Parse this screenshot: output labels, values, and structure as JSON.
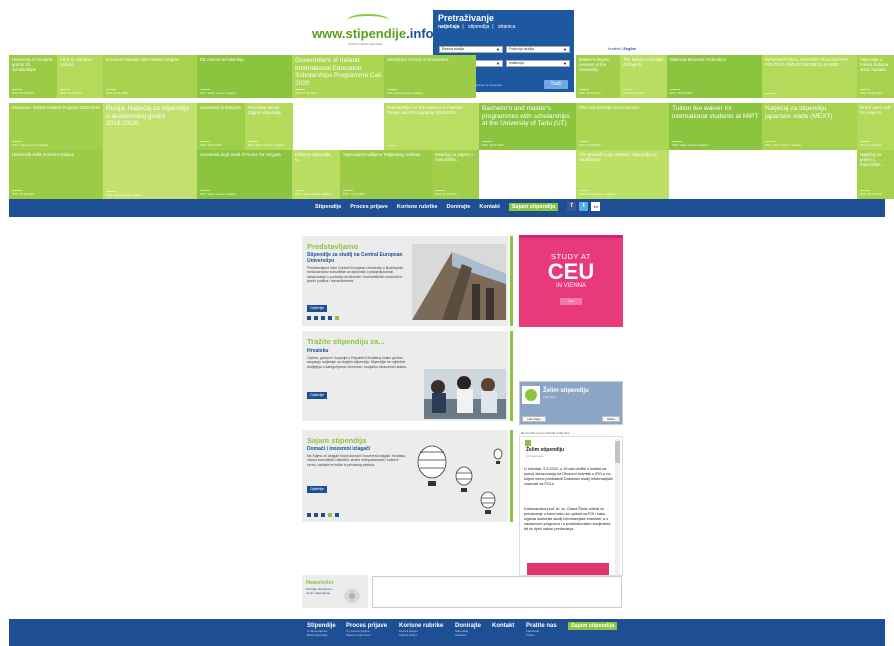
{
  "header": {
    "logo_text_main": "www.stipendije",
    "logo_text_domain": ".info",
    "logo_tagline": "Portal hrvatskih stipendija"
  },
  "search": {
    "title": "Pretraživanje",
    "tab_active": "natječaja",
    "tab_sep1": "|",
    "tab_2": "stipendija",
    "tab_sep2": "|",
    "tab_3": "stranica",
    "field_1": "Razina studija",
    "field_2": "Područje studija",
    "field_3": "Mjesto studija",
    "field_4": "Institucija",
    "note": "Pretraživanje objavljenih natječaja za stipendije",
    "button": "Traži"
  },
  "lang": {
    "hr": "Hrvatski",
    "sep": "|",
    "en": "English"
  },
  "tiles": [
    {
      "title": "University of Insubria grants 10 scholarships",
      "date": "ROK: 30.09.2020.",
      "small": true
    },
    {
      "title": "I.D.E.S. Summer School",
      "date": "ROK: 30.06.2020.",
      "small": true
    },
    {
      "title": "Erasmus Mundus Joint Master Degree",
      "date": "ROK: 30.01.2020.",
      "small": true
    },
    {
      "title": "DE Alumni Scholarship",
      "date": "ROK: stalno otvoren natječaj",
      "small": true
    },
    {
      "title": "Government of Ireland International Education Scholarships Programme Call 2020",
      "date": "ROK: 27.01.2020.",
      "small": false
    },
    {
      "title": "Stockholm School of Economics",
      "date": "ROK: stalno otvoren natječaj",
      "small": true
    },
    {
      "title": "Master's degree courses at the University",
      "date": "ROK: 10.03.2020.",
      "small": true
    },
    {
      "title": "The Italian Consulate of Zagreb",
      "date": "ROK: 31.03.2020.",
      "small": true
    },
    {
      "title": "Wallonia-Brussels Federation",
      "date": "ROK: 28.02.2020.",
      "small": true
    },
    {
      "title": "INTERNATIONAL MASTER: PHILOSOPHY, POLITICS AND ECONOMICS IN MED",
      "date": "",
      "small": true
    },
    {
      "title": "Stipendije u Fondu Šabana Jovic Šabana",
      "date": "ROK: 20.01.2020.",
      "small": true
    },
    {
      "title": "Erasmus+ Institut Pasteur Projects 2019-2010",
      "date": "ROK: stalno otvoren natječaj",
      "small": true
    },
    {
      "title": "Rusija: Natječaj za stipendije u akademskoj godini 2019./2020.",
      "date": "ROK: stalno otvoren natječaj",
      "small": false
    },
    {
      "title": "Università di Bologna",
      "date": "ROK: 10.02.2020.",
      "small": true
    },
    {
      "title": "Privredna banka Zagreb stipendije",
      "date": "ROK: stalno otvoren natječaj",
      "small": true
    },
    {
      "title": "Scholarships for the Masters in Fashion, Design and Photography 2020/2021",
      "date": "",
      "small": true
    },
    {
      "title": "Bachelor's and master's programmes with scholarships at the University of Tartu (UT)",
      "date": "ROK: 15.02.2020.",
      "small": false
    },
    {
      "title": "PhD scholarships in Economics",
      "date": "ROK: 10.08.2020.",
      "small": true
    },
    {
      "title": "Tuition fee waiver for international students at MIPT",
      "date": "ROK: stalno otvoren natječaj",
      "small": false
    },
    {
      "title": "Natječaj za stipendiju japanske vlade (MEXT)",
      "date": "ROK: stalno otvoren natječaj",
      "small": false
    },
    {
      "title": "RISIS open call for projects",
      "date": "ROK: 01.03.2020.",
      "small": true
    },
    {
      "title": "Università della Svizzera italiana",
      "date": "ROK: 10.01.2020.",
      "small": true
    },
    {
      "title": "Università degli Studi di Roma Tor Vergata",
      "date": "ROK: stalno otvoren natječaj",
      "small": true
    },
    {
      "title": "Državne stipendije u...",
      "date": "ROK: stalno otvoren natječaj",
      "small": true
    },
    {
      "title": "Stipendije/Izmišljene Talijanskog instituta",
      "date": "ROK: 12.03.2020.",
      "small": true
    },
    {
      "title": "Natječaj za prijem u Sveučilište...",
      "date": "ROK: 21.03.2020.",
      "small": true
    },
    {
      "title": "The Breakthrough Institute: Stipendije za istraživanje",
      "date": "ROK: stalno otvoren natječaj",
      "small": true
    },
    {
      "title": "Natječaj za prijem u Sveučilište...",
      "date": "ROK: 28.03.2020.",
      "small": true
    }
  ],
  "nav": {
    "items": [
      "Stipendije",
      "Proces prijave",
      "Korisne rubrike",
      "Donirajte",
      "Kontakt"
    ],
    "fair": "Sajam stipendija",
    "facebook": "f",
    "twitter": "t",
    "flickr": "●●"
  },
  "panels": {
    "p1": {
      "title": "Predstavljamo",
      "subtitle": "Stipendije za studij na Central European Universityu",
      "text": "Predstavljamo Vam Central European University u Budimpešti, međunarodno sveučilište za diplomski i poslijediplomski obrazovanje u području društvenih i humanističkih znanosti te javnih politika i menadžmenta.",
      "button": "Opširnije"
    },
    "p2": {
      "title": "Tražite stipendiju za...",
      "subtitle": "Hrvatsku",
      "text": "Općine, gradovi i županije u Republici Hrvatskoj svake godine raspisuju natječaje za dodjelu stipendija. Stipendije se najčešće dodjeljuju u kategorijama: izvrsnost i socijalno ekonomski status.",
      "button": "Opširnije"
    },
    "p3": {
      "title": "Sajam stipendija",
      "subtitle": "Domaći i inozemni izlagači",
      "text": "Na Sajmu će izlagati brojni domaći i inozemni izlagači: hrvatska, strana sveučilišta i fakulteti, strane veleposlanstva i kulturni centri, zaklade te tvrtke iz privatnog sektora.",
      "button": "Opširnije"
    }
  },
  "ads": {
    "ceu_line1": "STUDY AT",
    "ceu_line2": "CEU",
    "ceu_line3": "IN VIENNA",
    "ceu_button": "CEU"
  },
  "facebook": {
    "page_name": "Želim stipendiju",
    "page_likes": "7.3K likes",
    "like": "Like Page",
    "share": "Share",
    "feed_label": "Be the first of your friends to like this",
    "post_author": "Želim stipendiju",
    "post_time": "10 hours ago",
    "post_text_1": "U četvrtak, 5.3.2020. u 10 sati dođite u Institut za razvoj obrazovanja na Otvoreni četvrtak u IRO-u na kojem ćemo predstaviti Doktorski studij Informacijske znanosti na FOI-u.",
    "post_text_2": "Doktorandica prof. dr. sc. Diana Šimić održat će predavanje o tome kako se upisati na FOI i kako izgleda doktorski studij Informacijske znanosti, a o nastavnom programu i o postdoktorskim karijerama bit će riječi nakon predavanja."
  },
  "newsletter": {
    "title": "Newsletter",
    "text": "Primajte obavijesti o novim natječajima"
  },
  "footer": {
    "cols": [
      {
        "h": "Stipendije",
        "s1": "O stipendijama",
        "s2": "Baza stipendija"
      },
      {
        "h": "Proces prijave",
        "s1": "O procesu prijave",
        "s2": "Prijavni dokumenti"
      },
      {
        "h": "Korisne rubrike",
        "s1": "Korisni savjeti",
        "s2": "Korisni linkovi"
      },
      {
        "h": "Donirajte",
        "s1": "Stipendije",
        "s2": "Iskustva"
      },
      {
        "h": "Kontakt",
        "s1": "",
        "s2": ""
      },
      {
        "h": "Pratite nas",
        "s1": "Facebook",
        "s2": "Twitter"
      }
    ],
    "fair": "Sajam stipendija"
  },
  "colors": {
    "brand_blue": "#1e4f94",
    "brand_green": "#8bc53f"
  }
}
